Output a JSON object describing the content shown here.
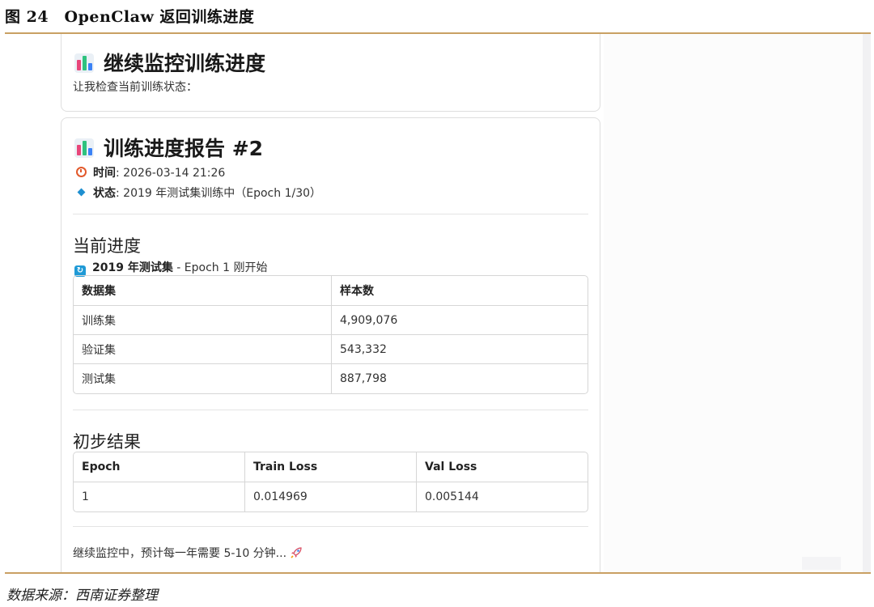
{
  "figure": {
    "title": "图 24　OpenClaw 返回训练进度",
    "source": "数据来源：西南证券整理"
  },
  "card1": {
    "heading": "继续监控训练进度",
    "heading_icon": "bar-chart-icon",
    "subtext": "让我检查当前训练状态："
  },
  "card2": {
    "heading": "训练进度报告 #2",
    "heading_icon": "bar-chart-icon",
    "time_label": "时间",
    "time_value": ": 2026-03-14 21:26",
    "status_label": "状态",
    "status_value": ": 2019 年测试集训练中（Epoch 1/30）",
    "progress_section": {
      "title": "当前进度",
      "subhead_bold": "2019 年测试集",
      "subhead_rest": " - Epoch 1 刚开始",
      "columns": [
        "数据集",
        "样本数"
      ],
      "rows": [
        [
          "训练集",
          "4,909,076"
        ],
        [
          "验证集",
          "543,332"
        ],
        [
          "测试集",
          "887,798"
        ]
      ]
    },
    "result_section": {
      "title": "初步结果",
      "columns": [
        "Epoch",
        "Train Loss",
        "Val Loss"
      ],
      "rows": [
        [
          "1",
          "0.014969",
          "0.005144"
        ]
      ]
    },
    "footer_note": "继续监控中，预计每一年需要 5-10 分钟...",
    "footer_icon": "rocket-icon"
  },
  "colors": {
    "rule": "#c9a063",
    "border": "#dedede",
    "clock": "#e2592b",
    "diamond": "#1e8fd0"
  }
}
